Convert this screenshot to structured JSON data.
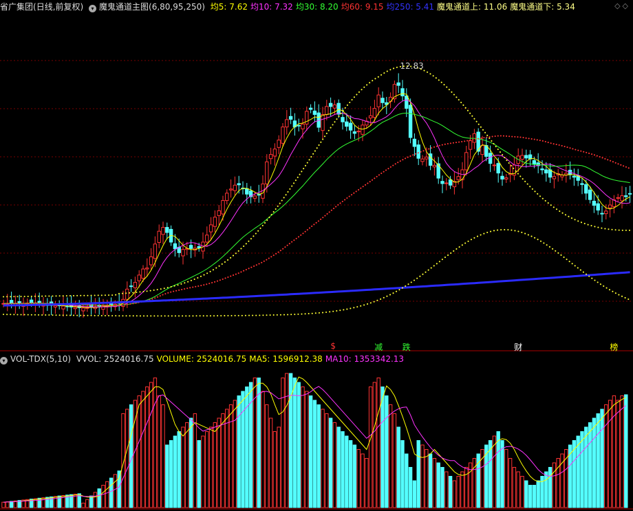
{
  "header": {
    "stock_name": "省广集团",
    "period": "(日线,前复权)",
    "indicator": "魔鬼通道主图(6,80,95,250)",
    "items": [
      {
        "label": "均5:",
        "value": "7.62",
        "color": "#ffff00"
      },
      {
        "label": "均10:",
        "value": "7.32",
        "color": "#ff33ff"
      },
      {
        "label": "均30:",
        "value": "8.20",
        "color": "#33ff33"
      },
      {
        "label": "均60:",
        "value": "9.15",
        "color": "#ff3333"
      },
      {
        "label": "均250:",
        "value": "5.41",
        "color": "#3333ff"
      },
      {
        "label": "魔鬼通道上:",
        "value": "11.06",
        "color": "#ffff88"
      },
      {
        "label": "魔鬼通道下:",
        "value": "5.34",
        "color": "#ffff88"
      }
    ]
  },
  "volume_header": {
    "indicator": "VOL-TDX(5,10)",
    "items": [
      {
        "label": "VVOL:",
        "value": "2524016.75",
        "color": "#dddddd"
      },
      {
        "label": "VOLUME:",
        "value": "2524016.75",
        "color": "#ffff00"
      },
      {
        "label": "MA5:",
        "value": "1596912.38",
        "color": "#ffff00"
      },
      {
        "label": "MA10:",
        "value": "1353342.13",
        "color": "#ff33ff"
      }
    ]
  },
  "signals": [
    {
      "text": "$",
      "index": 83,
      "color": "#ff3333"
    },
    {
      "text": "减",
      "index": 94,
      "color": "#33ff33"
    },
    {
      "text": "跌",
      "index": 101,
      "color": "#33ff33"
    },
    {
      "text": "财",
      "index": 129,
      "color": "#ffffff"
    },
    {
      "text": "榜",
      "index": 153,
      "color": "#ffff00"
    }
  ],
  "peak_label": "12.83",
  "colors": {
    "up": "#ff3333",
    "down": "#54ffff",
    "ma5": "#ffff00",
    "ma10": "#ff33ff",
    "ma30": "#33ff33",
    "ma60": "#ff3333",
    "ma250": "#2b2bff",
    "channel": "#ffff33",
    "grid": "#7a0000"
  },
  "chart_data": {
    "type": "candlestick",
    "y_range": [
      4.5,
      14.5
    ],
    "volume_range": [
      0,
      3200000
    ],
    "close": [
      5.44,
      5.44,
      5.44,
      5.45,
      5.45,
      5.45,
      5.45,
      5.46,
      5.46,
      5.46,
      5.4,
      5.39,
      5.38,
      5.37,
      5.37,
      5.36,
      5.35,
      5.33,
      5.32,
      5.31,
      5.3,
      5.31,
      5.33,
      5.34,
      5.36,
      5.37,
      5.38,
      5.39,
      5.42,
      5.45,
      5.57,
      5.89,
      5.98,
      6.1,
      6.33,
      6.52,
      6.55,
      6.9,
      7.3,
      7.7,
      7.82,
      7.66,
      7.36,
      7.15,
      7.03,
      7.13,
      7.16,
      7.16,
      7.17,
      7.18,
      7.36,
      7.58,
      7.9,
      8.14,
      8.34,
      8.66,
      8.89,
      9.02,
      9.14,
      9.15,
      9.03,
      8.86,
      8.78,
      8.8,
      8.83,
      9.18,
      9.87,
      10.1,
      10.27,
      10.55,
      10.96,
      11.19,
      11.2,
      10.96,
      11.0,
      11.05,
      11.45,
      11.51,
      11.35,
      10.95,
      11.35,
      11.6,
      11.6,
      11.65,
      11.36,
      11.12,
      10.98,
      10.86,
      10.76,
      10.83,
      11.02,
      11.14,
      11.31,
      11.54,
      11.96,
      11.72,
      11.66,
      11.89,
      12.29,
      12.26,
      11.93,
      11.54,
      10.63,
      10.35,
      9.98,
      9.96,
      10.02,
      9.76,
      9.76,
      9.36,
      9.19,
      9.21,
      9.14,
      9.26,
      9.41,
      9.62,
      10.16,
      10.53,
      10.75,
      10.2,
      10.38,
      10.04,
      9.82,
      9.77,
      9.52,
      9.33,
      9.37,
      9.5,
      9.77,
      10.05,
      10.07,
      9.99,
      9.96,
      9.79,
      9.75,
      9.62,
      9.52,
      9.39,
      9.41,
      9.5,
      9.46,
      9.51,
      9.47,
      9.39,
      9.29,
      9.16,
      8.89,
      8.69,
      8.51,
      8.36,
      8.25,
      8.33,
      8.52,
      8.68,
      8.75,
      8.81,
      8.78,
      8.86
    ],
    "volume": [
      120000,
      130000,
      140000,
      150000,
      160000,
      170000,
      180000,
      190000,
      200000,
      210000,
      220000,
      230000,
      240000,
      250000,
      260000,
      270000,
      280000,
      290000,
      300000,
      310000,
      100000,
      180000,
      260000,
      340000,
      420000,
      500000,
      580000,
      660000,
      740000,
      820000,
      2100000,
      2200000,
      2300000,
      2400000,
      2500000,
      2600000,
      2700000,
      2800000,
      2900000,
      2500000,
      2300000,
      1400000,
      1500000,
      1600000,
      1700000,
      1800000,
      1900000,
      2000000,
      2100000,
      1500000,
      1600000,
      1700000,
      1800000,
      1900000,
      2000000,
      2100000,
      2200000,
      2300000,
      2400000,
      2500000,
      2600000,
      2700000,
      2800000,
      2900000,
      2900000,
      2600000,
      2300000,
      2000000,
      1700000,
      1800000,
      2900000,
      3000000,
      3000000,
      2900000,
      2800000,
      2700000,
      2600000,
      2500000,
      2400000,
      2300000,
      2200000,
      2100000,
      2000000,
      1900000,
      1800000,
      1700000,
      1600000,
      1500000,
      1400000,
      1300000,
      1200000,
      1100000,
      2700000,
      2800000,
      2900000,
      2700000,
      2500000,
      2300000,
      2100000,
      1800000,
      1500000,
      1200000,
      900000,
      600000,
      1500000,
      1400000,
      1300000,
      1200000,
      1100000,
      1000000,
      900000,
      800000,
      700000,
      600000,
      700000,
      800000,
      900000,
      1000000,
      1100000,
      1200000,
      1300000,
      1400000,
      1500000,
      1600000,
      1700000,
      1500000,
      1300000,
      1100000,
      900000,
      800000,
      700000,
      600000,
      500000,
      500000,
      600000,
      700000,
      800000,
      900000,
      1000000,
      1100000,
      1200000,
      1300000,
      1400000,
      1500000,
      1600000,
      1700000,
      1800000,
      1900000,
      2000000,
      2100000,
      2200000,
      2300000,
      2400000,
      2500000,
      2400000,
      2500000,
      2524016
    ],
    "series_last": {
      "ma5": 7.62,
      "ma10": 7.32,
      "ma30": 8.2,
      "ma60": 9.15,
      "ma250": 5.41,
      "upper": 11.06,
      "lower": 5.34
    }
  }
}
